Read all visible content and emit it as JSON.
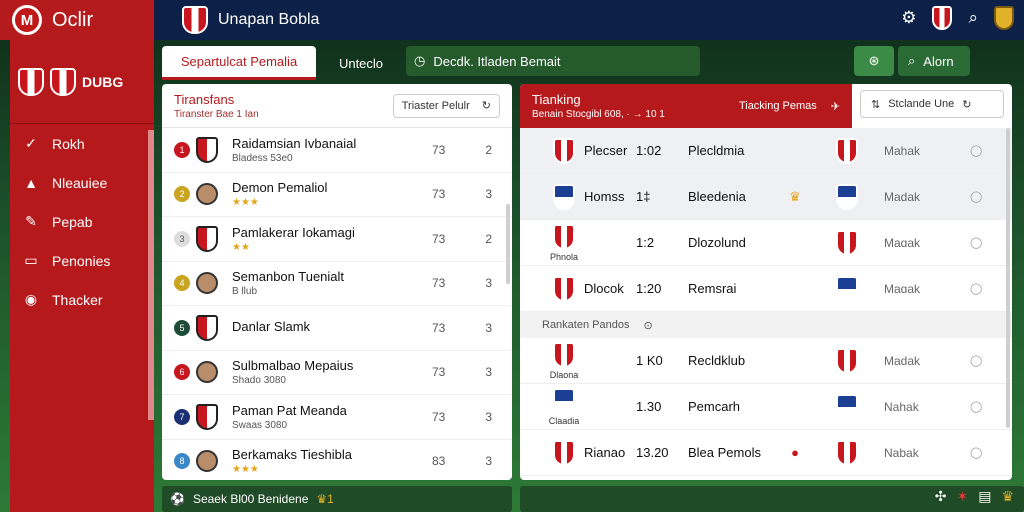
{
  "brand": {
    "name": "Oclir",
    "logo": "M"
  },
  "header": {
    "title": "Unapan Bobla"
  },
  "sidebar": {
    "club_label": "DUBG",
    "items": [
      {
        "label": "Rokh",
        "icon": "check-icon"
      },
      {
        "label": "Nleauiee",
        "icon": "triangle-icon"
      },
      {
        "label": "Pepab",
        "icon": "wrench-icon"
      },
      {
        "label": "Penonies",
        "icon": "box-icon"
      },
      {
        "label": "Thacker",
        "icon": "eye-icon"
      }
    ]
  },
  "tabs": {
    "active": "Separtulcat Pemalia",
    "second": "Unteclo",
    "search": "Decdk. Itladen Bemait"
  },
  "finder": {
    "label": "Alorn"
  },
  "transfers": {
    "title": "Tiransfans",
    "subtitle": "Tiranster Bae 1 Ian",
    "filter_label": "Triaster Pelulr",
    "rows": [
      {
        "name": "Raidamsian Ivbanaial",
        "info": "Bladess 53e0",
        "r1": "73",
        "r2": "2",
        "dot": "#c8161e",
        "num": "1"
      },
      {
        "name": "Demon Pemaliol",
        "info": "★★★",
        "r1": "73",
        "r2": "3",
        "dot": "#c9a41e",
        "num": "2"
      },
      {
        "name": "Pamlakerar Iokamagi",
        "info": "★★",
        "r1": "73",
        "r2": "2",
        "dot": "#dddddd",
        "num": "3"
      },
      {
        "name": "Semanbon Tuenialt",
        "info": "B llub",
        "r1": "73",
        "r2": "3",
        "dot": "#c9a41e",
        "num": "4"
      },
      {
        "name": "Danlar Slamk",
        "info": "",
        "r1": "73",
        "r2": "3",
        "dot": "#1d4d3a",
        "num": "5"
      },
      {
        "name": "Sulbmalbao Mepaius",
        "info": "Shado 3080",
        "r1": "73",
        "r2": "3",
        "dot": "#c8161e",
        "num": "6"
      },
      {
        "name": "Paman Pat Meanda",
        "info": "Swaas 3080",
        "r1": "73",
        "r2": "3",
        "dot": "#1a2f74",
        "num": "7"
      },
      {
        "name": "Berkamaks Tieshibla",
        "info": "★★★",
        "r1": "83",
        "r2": "3",
        "dot": "#3a88c7",
        "num": "8"
      }
    ]
  },
  "ranking": {
    "title": "Tianking",
    "subtitle": "Benain Stocgibl 608,  ·  →  10 1",
    "transfer_label": "Tiacking Pemas",
    "sort_label": "Stclande Une",
    "rows": [
      {
        "team": "Plecser",
        "sub": "",
        "score": "1:02",
        "opp": "Plecldmia",
        "flag": "",
        "result": "Mahak"
      },
      {
        "team": "Homss",
        "sub": "",
        "score": "1‡",
        "opp": "Bleedenia",
        "flag": "♛",
        "result": "Madak"
      },
      {
        "team": "",
        "sub": "Phnola",
        "score": "1:2",
        "opp": "Dlozolund",
        "flag": "",
        "result": "Maɑak"
      },
      {
        "team": "Dlocok",
        "sub": "",
        "score": "1:20",
        "opp": "Remsrai",
        "flag": "",
        "result": "Maɑak"
      }
    ],
    "section_label": "Rankaten Pandos",
    "rows2": [
      {
        "team": "",
        "sub": "Dlaona",
        "score": "1 K0",
        "opp": "Recldklub",
        "flag": "",
        "result": "Madak"
      },
      {
        "team": "",
        "sub": "Claadia",
        "score": "1.30",
        "opp": "Pemcarh",
        "flag": "",
        "result": "Nahak"
      },
      {
        "team": "Rianao",
        "sub": "",
        "score": "13.20",
        "opp": "Blea Pemols",
        "flag": "●",
        "result": "Nabak"
      }
    ]
  },
  "bottom": {
    "label": "Seaek Bl00 Benidene",
    "badge": "♛1"
  },
  "colors": {
    "brand_red": "#b51a1d",
    "navy": "#0d2148",
    "pitch_green": "#2d7a36"
  }
}
